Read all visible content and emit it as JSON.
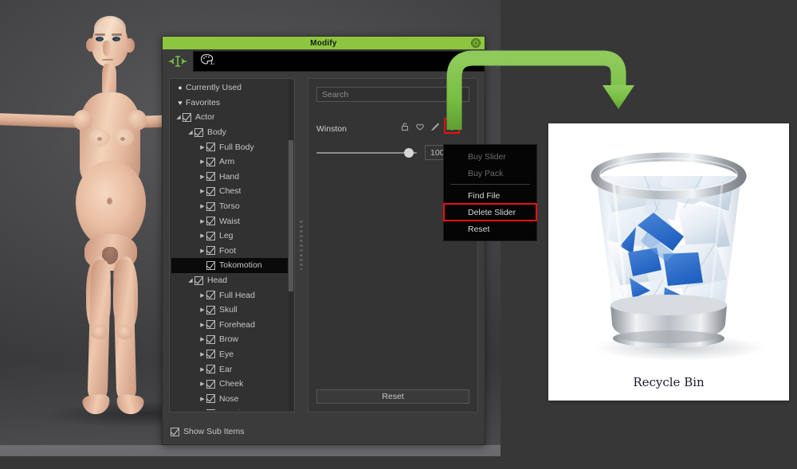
{
  "app": {
    "viewport_label": "character-viewport",
    "background_color": "#4a4a4c"
  },
  "panel": {
    "title": "Modify",
    "close_icon": "close-circle-icon",
    "accent_color": "#8cc63f",
    "toolbar": {
      "modify_icon": "modify-scale-icon",
      "palette_icon": "palette-icon"
    },
    "footer": {
      "show_sub_items_label": "Show Sub Items",
      "show_sub_items_checked": true
    }
  },
  "tree": {
    "items": [
      {
        "label": "Currently Used",
        "indent": 0,
        "marker": "dot",
        "arrow": "",
        "checkbox": false,
        "selected": false
      },
      {
        "label": "Favorites",
        "indent": 0,
        "marker": "heart",
        "arrow": "",
        "checkbox": false,
        "selected": false
      },
      {
        "label": "Actor",
        "indent": 0,
        "marker": "",
        "arrow": "down",
        "checkbox": true,
        "selected": false
      },
      {
        "label": "Body",
        "indent": 1,
        "marker": "",
        "arrow": "down",
        "checkbox": true,
        "selected": false
      },
      {
        "label": "Full Body",
        "indent": 2,
        "marker": "",
        "arrow": "right",
        "checkbox": true,
        "selected": false
      },
      {
        "label": "Arm",
        "indent": 2,
        "marker": "",
        "arrow": "right",
        "checkbox": true,
        "selected": false
      },
      {
        "label": "Hand",
        "indent": 2,
        "marker": "",
        "arrow": "right",
        "checkbox": true,
        "selected": false
      },
      {
        "label": "Chest",
        "indent": 2,
        "marker": "",
        "arrow": "right",
        "checkbox": true,
        "selected": false
      },
      {
        "label": "Torso",
        "indent": 2,
        "marker": "",
        "arrow": "right",
        "checkbox": true,
        "selected": false
      },
      {
        "label": "Waist",
        "indent": 2,
        "marker": "",
        "arrow": "right",
        "checkbox": true,
        "selected": false
      },
      {
        "label": "Leg",
        "indent": 2,
        "marker": "",
        "arrow": "right",
        "checkbox": true,
        "selected": false
      },
      {
        "label": "Foot",
        "indent": 2,
        "marker": "",
        "arrow": "right",
        "checkbox": true,
        "selected": false
      },
      {
        "label": "Tokomotion",
        "indent": 2,
        "marker": "",
        "arrow": "",
        "checkbox": true,
        "selected": true
      },
      {
        "label": "Head",
        "indent": 1,
        "marker": "",
        "arrow": "down",
        "checkbox": true,
        "selected": false
      },
      {
        "label": "Full Head",
        "indent": 2,
        "marker": "",
        "arrow": "right",
        "checkbox": true,
        "selected": false
      },
      {
        "label": "Skull",
        "indent": 2,
        "marker": "",
        "arrow": "right",
        "checkbox": true,
        "selected": false
      },
      {
        "label": "Forehead",
        "indent": 2,
        "marker": "",
        "arrow": "right",
        "checkbox": true,
        "selected": false
      },
      {
        "label": "Brow",
        "indent": 2,
        "marker": "",
        "arrow": "right",
        "checkbox": true,
        "selected": false
      },
      {
        "label": "Eye",
        "indent": 2,
        "marker": "",
        "arrow": "right",
        "checkbox": true,
        "selected": false
      },
      {
        "label": "Ear",
        "indent": 2,
        "marker": "",
        "arrow": "right",
        "checkbox": true,
        "selected": false
      },
      {
        "label": "Cheek",
        "indent": 2,
        "marker": "",
        "arrow": "right",
        "checkbox": true,
        "selected": false
      },
      {
        "label": "Nose",
        "indent": 2,
        "marker": "",
        "arrow": "right",
        "checkbox": true,
        "selected": false
      },
      {
        "label": "Mouth",
        "indent": 2,
        "marker": "",
        "arrow": "right",
        "checkbox": true,
        "selected": false
      }
    ]
  },
  "right_pane": {
    "search": {
      "placeholder": "Search",
      "value": ""
    },
    "slider": {
      "name": "Winston",
      "value": "100",
      "position_percent": 100,
      "icons": [
        {
          "name": "lock-icon",
          "glyph": "lock"
        },
        {
          "name": "heart-icon",
          "glyph": "heart"
        },
        {
          "name": "brush-icon",
          "glyph": "brush"
        },
        {
          "name": "gear-icon",
          "glyph": "gear",
          "highlighted": true,
          "highlight_color": "#e81010"
        }
      ]
    },
    "reset_label": "Reset"
  },
  "context_menu": {
    "items": [
      {
        "label": "Buy Slider",
        "disabled": true,
        "highlighted": false
      },
      {
        "label": "Buy Pack",
        "disabled": true,
        "highlighted": false
      },
      {
        "label": "Find File",
        "disabled": false,
        "highlighted": false
      },
      {
        "label": "Delete Slider",
        "disabled": false,
        "highlighted": true
      },
      {
        "label": "Reset",
        "disabled": false,
        "highlighted": false
      }
    ],
    "highlight_color": "#e81010"
  },
  "annotation": {
    "arrow_name": "green-callout-arrow",
    "arrow_color": "#7ac143",
    "direction": "from-gear-icon-to-recycle-bin"
  },
  "recycle_bin": {
    "label": "Recycle Bin",
    "state": "full",
    "icon_name": "recycle-bin-full-icon"
  }
}
